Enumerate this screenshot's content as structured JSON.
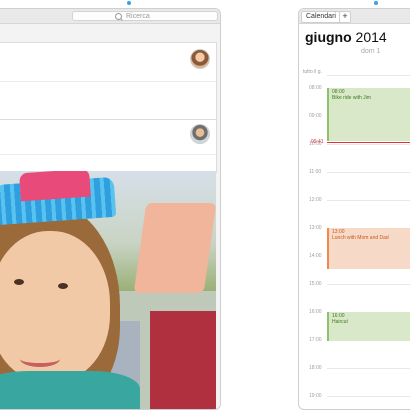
{
  "left_panel": {
    "search_placeholder": "Ricerca"
  },
  "calendar": {
    "calendars_label": "Calendari",
    "add_label": "+",
    "month": "giugno",
    "year": "2014",
    "weekday": "dom 1",
    "allday_label": "tutto il g.",
    "current_time": "09:41",
    "hours": [
      "08:00",
      "09:00",
      "10:00",
      "11:00",
      "12:00",
      "13:00",
      "14:00",
      "15:00",
      "16:00",
      "17:00",
      "18:00",
      "19:00"
    ],
    "events": [
      {
        "time": "08:00",
        "title": "Bike ride with Jim",
        "color": "#8fc06a"
      },
      {
        "time": "13:00",
        "title": "Lunch with Mom and Dad",
        "color": "#f08a4a"
      },
      {
        "time": "16:00",
        "title": "Haircut",
        "color": "#8fc06a"
      }
    ]
  },
  "colors": {
    "accent": "#3aa0e6",
    "now_line": "#e0303a"
  }
}
